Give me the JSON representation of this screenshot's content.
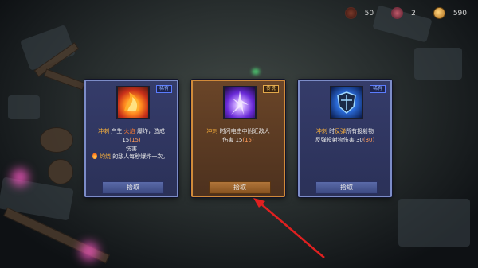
{
  "hud": {
    "souls": "50",
    "gems": "2",
    "gold": "590"
  },
  "cards": [
    {
      "badge": "稀有",
      "desc_1_a": "冲刺",
      "desc_1_b": " 产生 ",
      "desc_1_c": "火焰",
      "desc_1_d": " 爆炸，造成 15",
      "desc_1_e": "(15)",
      "desc_2": "伤害",
      "extra_a": "灼烧",
      "extra_b": " 的敌人每秒爆炸一次。",
      "button": "拾取"
    },
    {
      "badge": "传说",
      "desc_1_a": "冲刺",
      "desc_1_b": " 时闪电击中附近敌人",
      "desc_2_a": "伤害 15",
      "desc_2_b": "(15)",
      "button": "拾取"
    },
    {
      "badge": "稀有",
      "desc_1_a": "冲刺",
      "desc_1_b": " 时",
      "desc_1_c": "反弹",
      "desc_1_d": "所有投射物",
      "desc_2_a": "反弹投射物伤害 30",
      "desc_2_b": "(30)",
      "button": "拾取"
    }
  ],
  "colors": {
    "rare_border": "#7c8cc8",
    "legend_border": "#d08a3a",
    "highlight": "#ffb43a",
    "arrow": "#e02020"
  }
}
